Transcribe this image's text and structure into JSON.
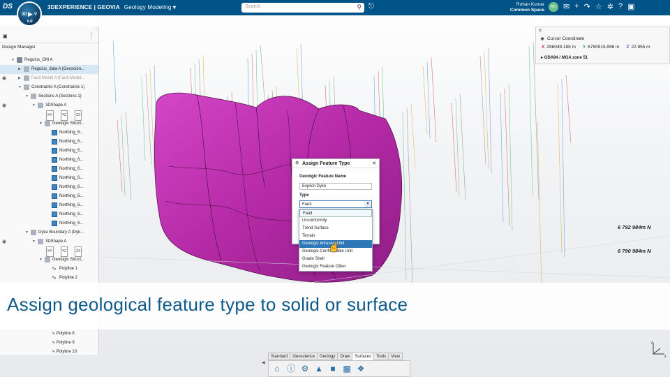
{
  "topbar": {
    "compass": {
      "label_3d": "3D",
      "label_v": "V",
      "version": "6.R"
    },
    "brand": "3DEXPERIENCE | GEOVIA",
    "app_name": "Geology Modeling",
    "search_placeholder": "Search",
    "user_name": "Rohan Kumar",
    "space": "Common Space",
    "avatar_initials": "RK",
    "notification_count": "3"
  },
  "left_panel": {
    "title": "Design Manager",
    "tree": [
      {
        "label": "Regulus_GM A",
        "indent": 1,
        "icon": "cube",
        "arrow": "down",
        "eye": false,
        "state": ""
      },
      {
        "label": "Regulus_data A (Geoscien...",
        "indent": 2,
        "icon": "grey",
        "arrow": "right",
        "eye": false,
        "state": "sel"
      },
      {
        "label": "Fault Model A (Fault Model...",
        "indent": 2,
        "icon": "grey",
        "arrow": "right",
        "eye": true,
        "state": "dim"
      },
      {
        "label": "Constraints A (Constraints 1)",
        "indent": 2,
        "icon": "grey",
        "arrow": "down",
        "eye": false,
        "state": ""
      },
      {
        "label": "Sections A (Sections 1)",
        "indent": 3,
        "icon": "grey",
        "arrow": "down",
        "eye": false,
        "state": ""
      },
      {
        "label": "3DShape A",
        "indent": 4,
        "icon": "grey",
        "arrow": "down",
        "eye": true,
        "state": ""
      },
      {
        "label": "",
        "indent": 5,
        "icon": "",
        "arrow": "",
        "eye": false,
        "state": "xyz"
      },
      {
        "label": "Geologic Struct...",
        "indent": 5,
        "icon": "grey",
        "arrow": "down",
        "eye": false,
        "state": ""
      },
      {
        "label": "Northing_6...",
        "indent": 6,
        "icon": "box",
        "arrow": "",
        "eye": false,
        "state": ""
      },
      {
        "label": "Northing_6...",
        "indent": 6,
        "icon": "box",
        "arrow": "",
        "eye": false,
        "state": ""
      },
      {
        "label": "Northing_6...",
        "indent": 6,
        "icon": "box",
        "arrow": "",
        "eye": false,
        "state": ""
      },
      {
        "label": "Northing_6...",
        "indent": 6,
        "icon": "box",
        "arrow": "",
        "eye": false,
        "state": ""
      },
      {
        "label": "Northing_6...",
        "indent": 6,
        "icon": "box",
        "arrow": "",
        "eye": false,
        "state": ""
      },
      {
        "label": "Northing_6...",
        "indent": 6,
        "icon": "box",
        "arrow": "",
        "eye": false,
        "state": ""
      },
      {
        "label": "Northing_6...",
        "indent": 6,
        "icon": "box",
        "arrow": "",
        "eye": false,
        "state": ""
      },
      {
        "label": "Northing_6...",
        "indent": 6,
        "icon": "box",
        "arrow": "",
        "eye": false,
        "state": ""
      },
      {
        "label": "Northing_6...",
        "indent": 6,
        "icon": "box",
        "arrow": "",
        "eye": false,
        "state": ""
      },
      {
        "label": "Northing_6...",
        "indent": 6,
        "icon": "box",
        "arrow": "",
        "eye": false,
        "state": ""
      },
      {
        "label": "Northing_6...",
        "indent": 6,
        "icon": "box",
        "arrow": "",
        "eye": false,
        "state": ""
      },
      {
        "label": "Dyke Boundary A (Dyk...",
        "indent": 3,
        "icon": "grey",
        "arrow": "down",
        "eye": false,
        "state": ""
      },
      {
        "label": "3DShape A",
        "indent": 4,
        "icon": "grey",
        "arrow": "down",
        "eye": true,
        "state": ""
      },
      {
        "label": "",
        "indent": 5,
        "icon": "",
        "arrow": "",
        "eye": false,
        "state": "xyz"
      },
      {
        "label": "Geologic Struct...",
        "indent": 5,
        "icon": "grey",
        "arrow": "down",
        "eye": false,
        "state": ""
      },
      {
        "label": "Polyline 1",
        "indent": 6,
        "icon": "pl",
        "arrow": "",
        "eye": false,
        "state": ""
      },
      {
        "label": "Polyline 2",
        "indent": 6,
        "icon": "pl",
        "arrow": "",
        "eye": false,
        "state": ""
      }
    ],
    "xyz_labels": [
      "XY",
      "YZ",
      "ZX"
    ],
    "bottom_tree": [
      "Polyline 8",
      "Polyline 9",
      "Polyline 10"
    ]
  },
  "cursor_coordinate": {
    "title": "Cursor Coordinate",
    "x_label": "X",
    "x_value": "296049.188 m",
    "y_label": "Y",
    "y_value": "6790515.996 m",
    "z_label": "Z",
    "z_value": "22.955 m",
    "crs": "GDA94 / MGA zone 51"
  },
  "scene": {
    "northing_labels": [
      "6 792 984m N",
      "6 790 984m N"
    ],
    "solid_color": "#c02fb8"
  },
  "dialog": {
    "title": "Assign Feature Type",
    "name_label": "Geologic Feature Name",
    "name_value": "Explicit Dyke",
    "type_label": "Type",
    "type_value": "Fault",
    "options": [
      "Fault",
      "Unconformity",
      "Trend Surface",
      "Terrain",
      "Geologic Intrusive Unit",
      "Geologic Conformable Unit",
      "Grade Shell",
      "Geologic Feature Other"
    ],
    "highlighted_index": 4
  },
  "caption": "Assign geological feature type to solid or surface",
  "action_bar": {
    "tabs": [
      "Standard",
      "Geoscience",
      "Geology",
      "Draw",
      "Surfaces",
      "Tools",
      "View"
    ],
    "active_tab": "Surfaces"
  }
}
